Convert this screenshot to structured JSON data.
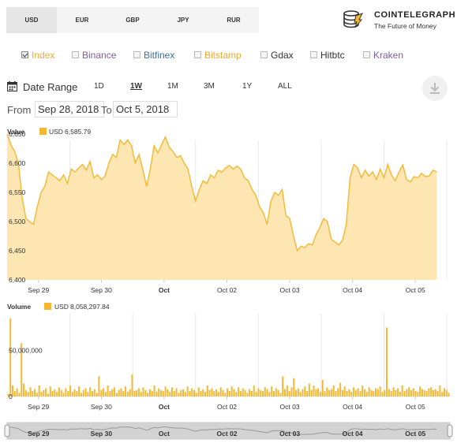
{
  "currencies": {
    "tabs": [
      "USD",
      "EUR",
      "GBP",
      "JPY",
      "RUR"
    ],
    "active": "USD"
  },
  "brand": {
    "name": "COINTELEGRAPH",
    "tagline": "The Future of Money"
  },
  "exchanges": [
    {
      "label": "Index",
      "checked": true,
      "color": "#f0a830"
    },
    {
      "label": "Binance",
      "checked": false,
      "color": "#7b5ea7"
    },
    {
      "label": "Bitfinex",
      "checked": false,
      "color": "#3a6fa8"
    },
    {
      "label": "Bitstamp",
      "checked": false,
      "color": "#f0a830"
    },
    {
      "label": "Gdax",
      "checked": false,
      "color": "#333333"
    },
    {
      "label": "Hitbtc",
      "checked": false,
      "color": "#333333"
    },
    {
      "label": "Kraken",
      "checked": false,
      "color": "#7b5ea7"
    }
  ],
  "range": {
    "label": "Date Range",
    "buttons": [
      "1D",
      "1W",
      "1M",
      "3M",
      "1Y",
      "ALL"
    ],
    "active": "1W",
    "from_label": "From",
    "from": "Sep 28, 2018",
    "to_label": "To",
    "to": "Oct 5, 2018"
  },
  "colors": {
    "area_fill": "#fde6b1",
    "line": "#f5b731",
    "bar": "#f5b731",
    "grid": "#e8e8e8"
  },
  "chart_data": [
    {
      "type": "area",
      "title": "Value",
      "legend": {
        "series": "USD",
        "value": "6,585.79"
      },
      "series": [
        {
          "name": "USD"
        }
      ],
      "x_tick_labels": [
        "Sep 29",
        "Sep 30",
        "Oct",
        "Oct 02",
        "Oct 03",
        "Oct 04",
        "Oct 05"
      ],
      "bold_tick": "Oct",
      "x_range_days": [
        0,
        7.05
      ],
      "x_ticks_days": [
        0.5,
        1.5,
        2.5,
        3.5,
        4.5,
        5.5,
        6.5
      ],
      "ylim": [
        6400,
        6650
      ],
      "y_ticks": [
        6400,
        6450,
        6500,
        6550,
        6600,
        6650
      ],
      "y_tick_labels": [
        "6,400",
        "6,450",
        "6,500",
        "6,550",
        "6,600",
        "6,650"
      ],
      "points": [
        [
          0.0,
          6650
        ],
        [
          0.06,
          6632
        ],
        [
          0.12,
          6620
        ],
        [
          0.18,
          6600
        ],
        [
          0.24,
          6540
        ],
        [
          0.3,
          6505
        ],
        [
          0.36,
          6500
        ],
        [
          0.42,
          6495
        ],
        [
          0.48,
          6525
        ],
        [
          0.54,
          6550
        ],
        [
          0.6,
          6560
        ],
        [
          0.66,
          6585
        ],
        [
          0.72,
          6580
        ],
        [
          0.78,
          6575
        ],
        [
          0.84,
          6570
        ],
        [
          0.9,
          6580
        ],
        [
          0.96,
          6565
        ],
        [
          1.02,
          6590
        ],
        [
          1.08,
          6585
        ],
        [
          1.14,
          6592
        ],
        [
          1.2,
          6598
        ],
        [
          1.26,
          6588
        ],
        [
          1.32,
          6603
        ],
        [
          1.38,
          6575
        ],
        [
          1.44,
          6580
        ],
        [
          1.5,
          6572
        ],
        [
          1.56,
          6578
        ],
        [
          1.62,
          6600
        ],
        [
          1.68,
          6615
        ],
        [
          1.74,
          6610
        ],
        [
          1.8,
          6640
        ],
        [
          1.86,
          6632
        ],
        [
          1.92,
          6640
        ],
        [
          1.98,
          6630
        ],
        [
          2.04,
          6600
        ],
        [
          2.1,
          6615
        ],
        [
          2.16,
          6590
        ],
        [
          2.22,
          6560
        ],
        [
          2.28,
          6590
        ],
        [
          2.34,
          6630
        ],
        [
          2.4,
          6618
        ],
        [
          2.46,
          6632
        ],
        [
          2.52,
          6645
        ],
        [
          2.58,
          6628
        ],
        [
          2.64,
          6620
        ],
        [
          2.7,
          6610
        ],
        [
          2.76,
          6613
        ],
        [
          2.82,
          6600
        ],
        [
          2.88,
          6590
        ],
        [
          2.94,
          6560
        ],
        [
          3.0,
          6535
        ],
        [
          3.06,
          6555
        ],
        [
          3.12,
          6570
        ],
        [
          3.18,
          6565
        ],
        [
          3.24,
          6580
        ],
        [
          3.3,
          6575
        ],
        [
          3.36,
          6588
        ],
        [
          3.42,
          6585
        ],
        [
          3.48,
          6592
        ],
        [
          3.54,
          6596
        ],
        [
          3.6,
          6590
        ],
        [
          3.66,
          6595
        ],
        [
          3.72,
          6590
        ],
        [
          3.78,
          6575
        ],
        [
          3.84,
          6570
        ],
        [
          3.9,
          6555
        ],
        [
          3.96,
          6545
        ],
        [
          4.02,
          6525
        ],
        [
          4.08,
          6515
        ],
        [
          4.14,
          6495
        ],
        [
          4.2,
          6535
        ],
        [
          4.26,
          6550
        ],
        [
          4.32,
          6545
        ],
        [
          4.38,
          6555
        ],
        [
          4.44,
          6510
        ],
        [
          4.5,
          6505
        ],
        [
          4.56,
          6475
        ],
        [
          4.62,
          6450
        ],
        [
          4.68,
          6458
        ],
        [
          4.74,
          6455
        ],
        [
          4.8,
          6462
        ],
        [
          4.86,
          6460
        ],
        [
          4.92,
          6478
        ],
        [
          4.98,
          6490
        ],
        [
          5.04,
          6505
        ],
        [
          5.1,
          6500
        ],
        [
          5.16,
          6470
        ],
        [
          5.22,
          6465
        ],
        [
          5.28,
          6460
        ],
        [
          5.34,
          6468
        ],
        [
          5.4,
          6495
        ],
        [
          5.46,
          6575
        ],
        [
          5.52,
          6598
        ],
        [
          5.58,
          6592
        ],
        [
          5.64,
          6575
        ],
        [
          5.7,
          6588
        ],
        [
          5.76,
          6578
        ],
        [
          5.82,
          6585
        ],
        [
          5.88,
          6572
        ],
        [
          5.94,
          6590
        ],
        [
          6.0,
          6575
        ],
        [
          6.06,
          6598
        ],
        [
          6.12,
          6580
        ],
        [
          6.18,
          6570
        ],
        [
          6.24,
          6585
        ],
        [
          6.3,
          6597
        ],
        [
          6.36,
          6572
        ],
        [
          6.42,
          6568
        ],
        [
          6.48,
          6577
        ],
        [
          6.54,
          6575
        ],
        [
          6.6,
          6583
        ],
        [
          6.66,
          6577
        ],
        [
          6.72,
          6578
        ],
        [
          6.78,
          6588
        ],
        [
          6.84,
          6585
        ]
      ]
    },
    {
      "type": "bar",
      "title": "Volume",
      "legend": {
        "series": "USD",
        "value": "8,058,297.84"
      },
      "series": [
        {
          "name": "USD"
        }
      ],
      "x_tick_labels": [
        "Sep 29",
        "Sep 30",
        "Oct",
        "Oct 02",
        "Oct 03",
        "Oct 04",
        "Oct 05"
      ],
      "bold_tick": "Oct",
      "ylim": [
        0,
        90000000
      ],
      "y_tick_labels": [
        "0",
        "50,000,000"
      ],
      "y_ticks": [
        0,
        50000000
      ],
      "values": [
        3000000,
        85000000,
        12000000,
        6000000,
        9000000,
        4000000,
        58000000,
        14000000,
        7000000,
        5000000,
        10000000,
        6000000,
        8000000,
        4000000,
        12000000,
        5000000,
        7000000,
        9000000,
        3000000,
        11000000,
        6000000,
        8000000,
        5000000,
        10000000,
        7000000,
        4000000,
        9000000,
        6000000,
        12000000,
        5000000,
        8000000,
        6000000,
        11000000,
        4000000,
        7000000,
        9000000,
        5000000,
        10000000,
        6000000,
        8000000,
        4000000,
        22000000,
        7000000,
        9000000,
        5000000,
        12000000,
        6000000,
        8000000,
        10000000,
        4000000,
        7000000,
        9000000,
        6000000,
        11000000,
        5000000,
        8000000,
        24000000,
        6000000,
        7000000,
        9000000,
        5000000,
        10000000,
        7000000,
        4000000,
        8000000,
        6000000,
        12000000,
        5000000,
        9000000,
        7000000,
        6000000,
        11000000,
        8000000,
        5000000,
        10000000,
        6000000,
        9000000,
        4000000,
        7000000,
        8000000,
        5000000,
        11000000,
        6000000,
        9000000,
        7000000,
        4000000,
        10000000,
        6000000,
        8000000,
        5000000,
        12000000,
        7000000,
        9000000,
        6000000,
        8000000,
        5000000,
        10000000,
        7000000,
        4000000,
        9000000,
        6000000,
        11000000,
        8000000,
        5000000,
        10000000,
        6000000,
        9000000,
        7000000,
        4000000,
        8000000,
        6000000,
        12000000,
        5000000,
        9000000,
        7000000,
        6000000,
        10000000,
        8000000,
        5000000,
        11000000,
        6000000,
        9000000,
        7000000,
        4000000,
        22000000,
        8000000,
        12000000,
        6000000,
        10000000,
        20000000,
        7000000,
        9000000,
        5000000,
        8000000,
        11000000,
        6000000,
        14000000,
        7000000,
        12000000,
        8000000,
        9000000,
        5000000,
        18000000,
        6000000,
        10000000,
        7000000,
        8000000,
        12000000,
        6000000,
        9000000,
        15000000,
        7000000,
        11000000,
        6000000,
        8000000,
        5000000,
        10000000,
        7000000,
        9000000,
        6000000,
        12000000,
        8000000,
        5000000,
        10000000,
        7000000,
        6000000,
        9000000,
        8000000,
        11000000,
        5000000,
        7000000,
        75000000,
        8000000,
        6000000,
        10000000,
        7000000,
        9000000,
        5000000,
        12000000,
        6000000,
        8000000,
        10000000,
        7000000,
        9000000,
        6000000,
        5000000,
        11000000,
        8000000,
        7000000,
        6000000,
        9000000,
        10000000,
        7000000,
        8000000,
        6000000,
        12000000,
        5000000,
        9000000,
        7000000,
        4000000
      ]
    }
  ],
  "navigator": {
    "labels": [
      "Sep 29",
      "Sep 30",
      "Oct",
      "Oct 02",
      "Oct 03",
      "Oct 04",
      "Oct 05"
    ]
  }
}
